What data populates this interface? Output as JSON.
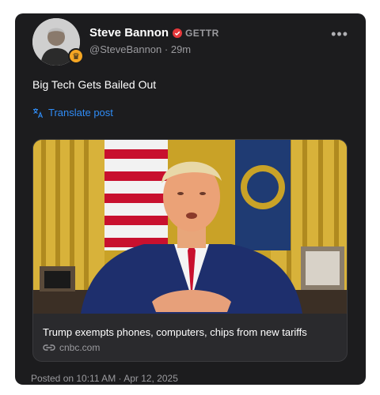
{
  "author": {
    "name": "Steve Bannon",
    "handle": "@SteveBannon",
    "time_ago": "29m",
    "platform": "GETTR",
    "avatar_icon": "person-avatar",
    "badge_icon": "crown-badge-icon",
    "verified_icon": "verified-badge-icon",
    "verified_color": "#e5383b"
  },
  "more_icon": "more-horizontal-icon",
  "more_glyph": "•••",
  "post": {
    "text": "Big Tech Gets Bailed Out",
    "translate_label": "Translate post",
    "translate_icon": "translate-icon"
  },
  "link_preview": {
    "title": "Trump exempts phones, computers, chips from new tariffs",
    "domain": "cnbc.com",
    "link_icon": "link-icon",
    "image": "news-photo"
  },
  "footer": {
    "posted_label": "Posted on 10:11 AM · Apr 12, 2025"
  },
  "colors": {
    "card_bg": "#1c1c1e",
    "accent": "#2f8cf6",
    "muted_text": "#9a9a9e"
  }
}
